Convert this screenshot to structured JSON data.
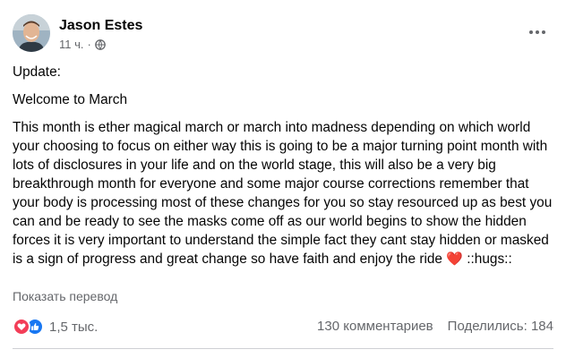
{
  "post": {
    "author": "Jason Estes",
    "time": "11 ч.",
    "separator": "·",
    "audience_icon": "globe-icon",
    "more_icon": "ellipsis-icon",
    "update_line": "Update:",
    "welcome_line": "Welcome to March",
    "body_text": "This month is ether magical march or march into madness depending on which world your choosing to focus on either way this is going to be a major turning point month with lots of disclosures in your life and on the world stage, this will also be a very big breakthrough month for everyone and some major course corrections remember that your body is processing most of these changes for you so stay resourced up as best you can and be ready to see the masks come off as our world begins to show the hidden forces it is very important to understand the simple fact they cant stay hidden or masked is a sign of progress and great change so have faith and enjoy the ride",
    "heart_emoji": "❤️",
    "hugs_text": " ::hugs::",
    "translate_link": "Показать перевод"
  },
  "engagement": {
    "reaction_icons": [
      "love-reaction-icon",
      "like-reaction-icon"
    ],
    "reactions_count": "1,5 тыс.",
    "comments": "130 комментариев",
    "shares": "Поделились: 184"
  },
  "colors": {
    "text": "#050505",
    "secondary": "#65676b",
    "love": "#f33e58",
    "like": "#1877f2"
  }
}
